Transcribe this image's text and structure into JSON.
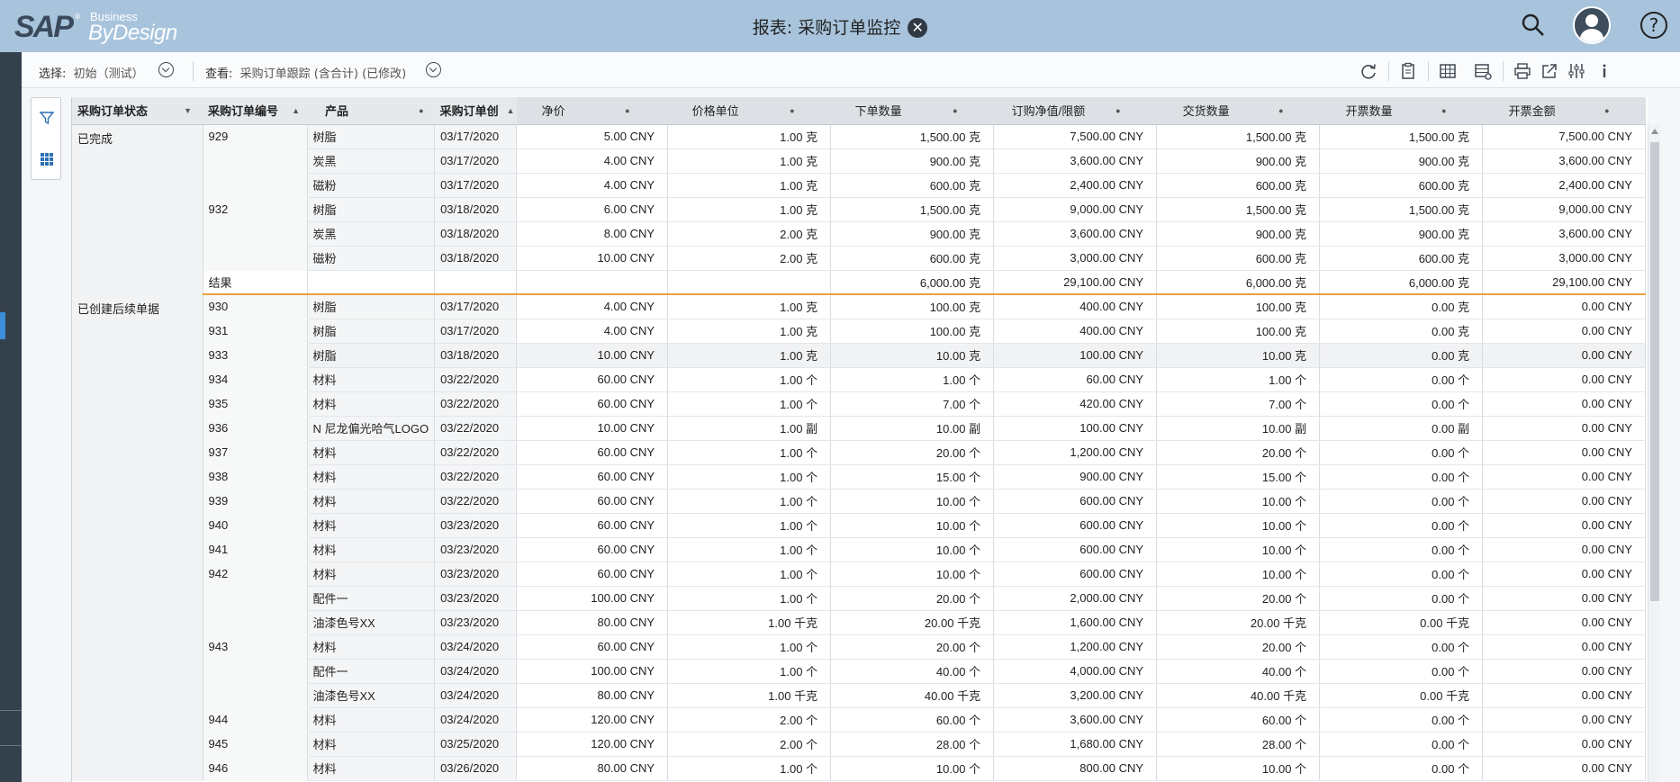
{
  "shell": {
    "logo_sap": "SAP",
    "logo_reg": "®",
    "logo_business": "Business",
    "logo_bydesign": "ByDesign",
    "title": "报表: 采购订单监控",
    "close_glyph": "✕",
    "help_glyph": "?"
  },
  "toolbar": {
    "select_label": "选择:",
    "select_value": "初始（测试）",
    "view_label": "查看:",
    "view_value": "采购订单跟踪 (含合计) (已修改)"
  },
  "table": {
    "headers": [
      "采购订单状态",
      "采购订单编号",
      "产品",
      "采购订单创",
      "净价",
      "价格单位",
      "下单数量",
      "订购净值/限额",
      "交货数量",
      "开票数量",
      "开票金额"
    ],
    "groups": [
      {
        "status": "已完成",
        "orders": [
          {
            "id": "929",
            "rows": [
              [
                "树脂",
                "03/17/2020",
                "5.00 CNY",
                "1.00 克",
                "1,500.00 克",
                "7,500.00 CNY",
                "1,500.00 克",
                "1,500.00 克",
                "7,500.00 CNY"
              ],
              [
                "炭黑",
                "03/17/2020",
                "4.00 CNY",
                "1.00 克",
                "900.00 克",
                "3,600.00 CNY",
                "900.00 克",
                "900.00 克",
                "3,600.00 CNY"
              ],
              [
                "磁粉",
                "03/17/2020",
                "4.00 CNY",
                "1.00 克",
                "600.00 克",
                "2,400.00 CNY",
                "600.00 克",
                "600.00 克",
                "2,400.00 CNY"
              ]
            ]
          },
          {
            "id": "932",
            "rows": [
              [
                "树脂",
                "03/18/2020",
                "6.00 CNY",
                "1.00 克",
                "1,500.00 克",
                "9,000.00 CNY",
                "1,500.00 克",
                "1,500.00 克",
                "9,000.00 CNY"
              ],
              [
                "炭黑",
                "03/18/2020",
                "8.00 CNY",
                "2.00 克",
                "900.00 克",
                "3,600.00 CNY",
                "900.00 克",
                "900.00 克",
                "3,600.00 CNY"
              ],
              [
                "磁粉",
                "03/18/2020",
                "10.00 CNY",
                "2.00 克",
                "600.00 克",
                "3,000.00 CNY",
                "600.00 克",
                "600.00 克",
                "3,000.00 CNY"
              ]
            ]
          }
        ],
        "result": {
          "label": "结果",
          "values": [
            "",
            "",
            "",
            "",
            "6,000.00 克",
            "29,100.00 CNY",
            "6,000.00 克",
            "6,000.00 克",
            "29,100.00 CNY"
          ]
        }
      },
      {
        "status": "已创建后续单据",
        "orders": [
          {
            "id": "930",
            "rows": [
              [
                "树脂",
                "03/17/2020",
                "4.00 CNY",
                "1.00 克",
                "100.00 克",
                "400.00 CNY",
                "100.00 克",
                "0.00 克",
                "0.00 CNY"
              ]
            ]
          },
          {
            "id": "931",
            "rows": [
              [
                "树脂",
                "03/17/2020",
                "4.00 CNY",
                "1.00 克",
                "100.00 克",
                "400.00 CNY",
                "100.00 克",
                "0.00 克",
                "0.00 CNY"
              ]
            ]
          },
          {
            "id": "933",
            "highlight": true,
            "rows": [
              [
                "树脂",
                "03/18/2020",
                "10.00 CNY",
                "1.00 克",
                "10.00 克",
                "100.00 CNY",
                "10.00 克",
                "0.00 克",
                "0.00 CNY"
              ]
            ]
          },
          {
            "id": "934",
            "rows": [
              [
                "材料",
                "03/22/2020",
                "60.00 CNY",
                "1.00 个",
                "1.00 个",
                "60.00 CNY",
                "1.00 个",
                "0.00 个",
                "0.00 CNY"
              ]
            ]
          },
          {
            "id": "935",
            "rows": [
              [
                "材料",
                "03/22/2020",
                "60.00 CNY",
                "1.00 个",
                "7.00 个",
                "420.00 CNY",
                "7.00 个",
                "0.00 个",
                "0.00 CNY"
              ]
            ]
          },
          {
            "id": "936",
            "rows": [
              [
                "N 尼龙偏光哈气LOGO",
                "03/22/2020",
                "10.00 CNY",
                "1.00 副",
                "10.00 副",
                "100.00 CNY",
                "10.00 副",
                "0.00 副",
                "0.00 CNY"
              ]
            ]
          },
          {
            "id": "937",
            "rows": [
              [
                "材料",
                "03/22/2020",
                "60.00 CNY",
                "1.00 个",
                "20.00 个",
                "1,200.00 CNY",
                "20.00 个",
                "0.00 个",
                "0.00 CNY"
              ]
            ]
          },
          {
            "id": "938",
            "rows": [
              [
                "材料",
                "03/22/2020",
                "60.00 CNY",
                "1.00 个",
                "15.00 个",
                "900.00 CNY",
                "15.00 个",
                "0.00 个",
                "0.00 CNY"
              ]
            ]
          },
          {
            "id": "939",
            "rows": [
              [
                "材料",
                "03/22/2020",
                "60.00 CNY",
                "1.00 个",
                "10.00 个",
                "600.00 CNY",
                "10.00 个",
                "0.00 个",
                "0.00 CNY"
              ]
            ]
          },
          {
            "id": "940",
            "rows": [
              [
                "材料",
                "03/23/2020",
                "60.00 CNY",
                "1.00 个",
                "10.00 个",
                "600.00 CNY",
                "10.00 个",
                "0.00 个",
                "0.00 CNY"
              ]
            ]
          },
          {
            "id": "941",
            "rows": [
              [
                "材料",
                "03/23/2020",
                "60.00 CNY",
                "1.00 个",
                "10.00 个",
                "600.00 CNY",
                "10.00 个",
                "0.00 个",
                "0.00 CNY"
              ]
            ]
          },
          {
            "id": "942",
            "rows": [
              [
                "材料",
                "03/23/2020",
                "60.00 CNY",
                "1.00 个",
                "10.00 个",
                "600.00 CNY",
                "10.00 个",
                "0.00 个",
                "0.00 CNY"
              ],
              [
                "配件一",
                "03/23/2020",
                "100.00 CNY",
                "1.00 个",
                "20.00 个",
                "2,000.00 CNY",
                "20.00 个",
                "0.00 个",
                "0.00 CNY"
              ],
              [
                "油漆色号XX",
                "03/23/2020",
                "80.00 CNY",
                "1.00 千克",
                "20.00 千克",
                "1,600.00 CNY",
                "20.00 千克",
                "0.00 千克",
                "0.00 CNY"
              ]
            ]
          },
          {
            "id": "943",
            "rows": [
              [
                "材料",
                "03/24/2020",
                "60.00 CNY",
                "1.00 个",
                "20.00 个",
                "1,200.00 CNY",
                "20.00 个",
                "0.00 个",
                "0.00 CNY"
              ],
              [
                "配件一",
                "03/24/2020",
                "100.00 CNY",
                "1.00 个",
                "40.00 个",
                "4,000.00 CNY",
                "40.00 个",
                "0.00 个",
                "0.00 CNY"
              ],
              [
                "油漆色号XX",
                "03/24/2020",
                "80.00 CNY",
                "1.00 千克",
                "40.00 千克",
                "3,200.00 CNY",
                "40.00 千克",
                "0.00 千克",
                "0.00 CNY"
              ]
            ]
          },
          {
            "id": "944",
            "rows": [
              [
                "材料",
                "03/24/2020",
                "120.00 CNY",
                "2.00 个",
                "60.00 个",
                "3,600.00 CNY",
                "60.00 个",
                "0.00 个",
                "0.00 CNY"
              ]
            ]
          },
          {
            "id": "945",
            "rows": [
              [
                "材料",
                "03/25/2020",
                "120.00 CNY",
                "2.00 个",
                "28.00 个",
                "1,680.00 CNY",
                "28.00 个",
                "0.00 个",
                "0.00 CNY"
              ]
            ]
          },
          {
            "id": "946",
            "rows": [
              [
                "材料",
                "03/26/2020",
                "80.00 CNY",
                "1.00 个",
                "10.00 个",
                "800.00 CNY",
                "10.00 个",
                "0.00 个",
                "0.00 CNY"
              ]
            ]
          }
        ]
      }
    ]
  }
}
